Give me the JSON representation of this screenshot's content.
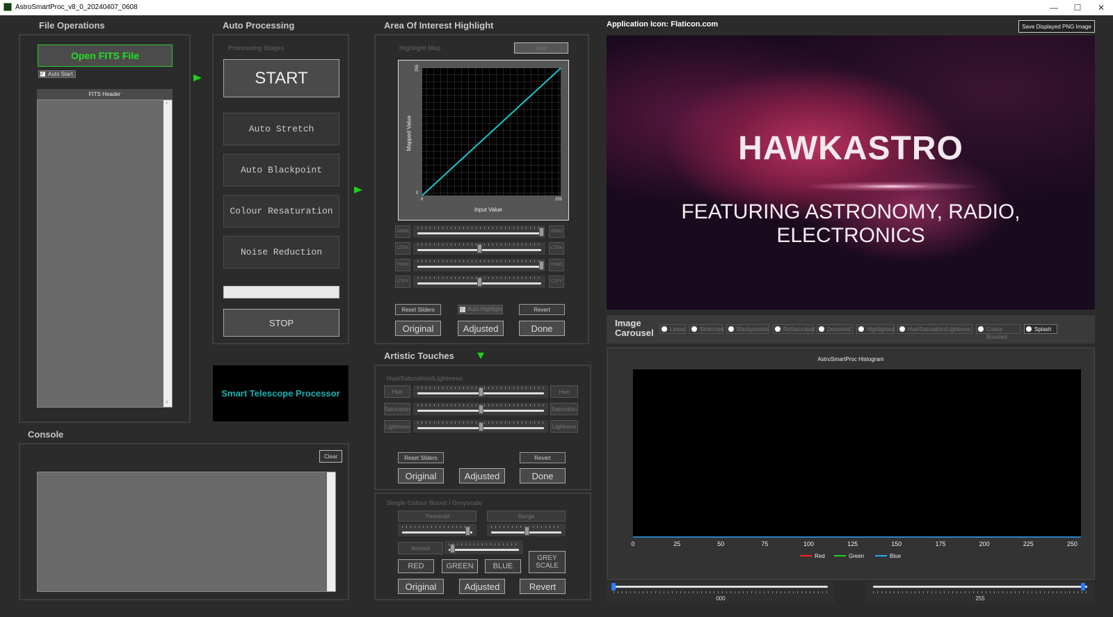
{
  "window": {
    "title": "AstroSmartProc_v8_0_20240407_0608",
    "minimize": "—",
    "maximize": "☐",
    "close": "✕"
  },
  "file_ops": {
    "header": "File Operations",
    "open_button": "Open FITS File",
    "auto_start_label": "Auto Start",
    "fits_header_label": "FITS Header"
  },
  "auto_proc": {
    "header": "Auto Processing",
    "stages_label": "Processing Stages",
    "start": "START",
    "stages": [
      "Auto Stretch",
      "Auto Blackpoint",
      "Colour Resaturation",
      "Noise Reduction"
    ],
    "stop": "STOP",
    "banner": "Smart Telescope Processor"
  },
  "console": {
    "header": "Console",
    "clear": "Clear"
  },
  "aoi": {
    "header": "Area Of Interest Highlight",
    "map_label": "Highlight Map",
    "help": "Help",
    "y_label": "Mapped Value",
    "x_label": "Input Value",
    "y_top": "255",
    "y_bottom": "0",
    "x_left": "0",
    "x_right": "255",
    "sliders": [
      {
        "left": "XRNG",
        "right": "XRNG",
        "value": 1.0
      },
      {
        "left": "CTPX",
        "right": "CTPX",
        "value": 0.5
      },
      {
        "left": "YRNG",
        "right": "YRNG",
        "value": 1.0
      },
      {
        "left": "CTPY",
        "right": "CTPY",
        "value": 0.5
      }
    ],
    "reset": "Reset Sliders",
    "auto_highlight": "Auto Highlight",
    "revert": "Revert",
    "original": "Original",
    "adjusted": "Adjusted",
    "done": "Done"
  },
  "artistic": {
    "header": "Artistic Touches",
    "hsl_label": "Hue/Saturation/Lightness",
    "sliders": [
      {
        "left": "Hue",
        "right": "Hue",
        "value": 0.5
      },
      {
        "left": "Saturation",
        "right": "Saturation",
        "value": 0.5
      },
      {
        "left": "Lightness",
        "right": "Lightness",
        "value": 0.5
      }
    ],
    "reset": "Reset Sliders",
    "revert": "Revert",
    "original": "Original",
    "adjusted": "Adjusted",
    "done": "Done"
  },
  "single_colour": {
    "label": "Single Colour Boost / Greyscale",
    "threshold": "Threshold",
    "range": "Range",
    "amount": "Amount",
    "threshold_value": 0.93,
    "range_value": 0.5,
    "amount_value": 0.05,
    "red": "RED",
    "green": "GREEN",
    "blue": "BLUE",
    "grey_scale": "GREY SCALE",
    "original": "Original",
    "adjusted": "Adjusted",
    "revert": "Revert"
  },
  "image": {
    "icon_credit": "Application Icon: Flaticon.com",
    "save_button": "Save Displayed PNG Image",
    "splash_title": "HAWKASTRO",
    "splash_subtitle": "FEATURING ASTRONOMY, RADIO, ELECTRONICS"
  },
  "carousel": {
    "label": "Image Carousel",
    "options": [
      "Linear",
      "Stretched",
      "Blackpointed",
      "ReSaturated",
      "Denoised",
      "Highlighted",
      "Hue/Saturation/Lightness",
      "Colour Boosted",
      "Splash"
    ],
    "selected": "Splash"
  },
  "chart_data": {
    "type": "line",
    "title": "AstroSmartProc Histogram",
    "xlabel": "",
    "ylabel": "",
    "x_ticks": [
      0,
      25,
      50,
      75,
      100,
      125,
      150,
      175,
      200,
      225,
      250
    ],
    "xlim": [
      0,
      255
    ],
    "series": [
      {
        "name": "Red",
        "color": "#ff2020",
        "values": []
      },
      {
        "name": "Green",
        "color": "#20d020",
        "values": []
      },
      {
        "name": "Blue",
        "color": "#2aa8ff",
        "values": []
      }
    ],
    "legend": "bottom-center",
    "background": "#000000"
  },
  "range_sliders": {
    "low_value": "000",
    "high_value": "255",
    "low": 0.0,
    "high": 1.0
  }
}
